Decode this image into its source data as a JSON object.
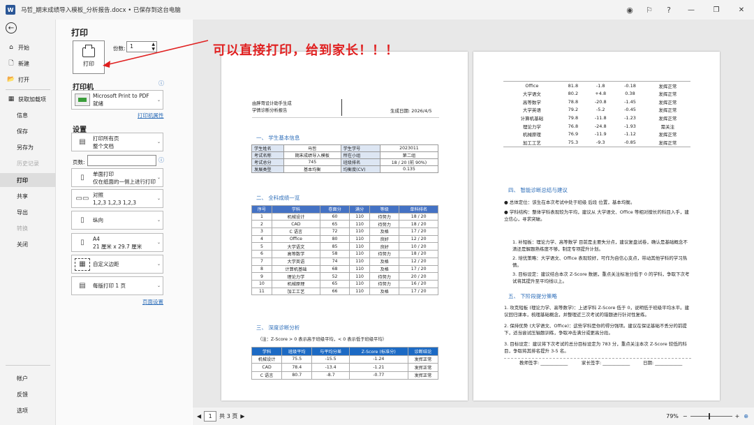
{
  "titlebar": {
    "app_icon": "W",
    "title": "马哲_期末成绩导入模板_分析报告.docx • 已保存到这台电脑"
  },
  "sidebar": {
    "items": [
      {
        "label": "开始",
        "icon": "⌂"
      },
      {
        "label": "新建",
        "icon": "🗋"
      },
      {
        "label": "打开",
        "icon": "📂"
      },
      {
        "label": "获取加载项",
        "icon": "▦"
      },
      {
        "label": "信息"
      },
      {
        "label": "保存"
      },
      {
        "label": "另存为"
      },
      {
        "label": "历史记录"
      },
      {
        "label": "打印"
      },
      {
        "label": "共享"
      },
      {
        "label": "导出"
      },
      {
        "label": "转换"
      },
      {
        "label": "关闭"
      }
    ],
    "bottom": [
      {
        "label": "帐户"
      },
      {
        "label": "反馈"
      },
      {
        "label": "选项"
      }
    ]
  },
  "print_panel": {
    "title": "打印",
    "print_button": "打印",
    "copies_label": "份数:",
    "copies_value": "1",
    "printer_section": "打印机",
    "printer_name": "Microsoft Print to PDF",
    "printer_status": "就绪",
    "printer_props": "打印机属性",
    "settings_section": "设置",
    "opt1_a": "打印所有页",
    "opt1_b": "整个文档",
    "pages_label": "页数:",
    "opt2_a": "单面打印",
    "opt2_b": "仅在纸面的一侧上进行打印",
    "opt3_a": "对照",
    "opt3_b": "1,2,3    1,2,3    1,2,3",
    "opt4_a": "纵向",
    "opt5_a": "A4",
    "opt5_b": "21 厘米 x 29.7 厘米",
    "opt6_a": "自定义边距",
    "opt7_a": "每版打印 1 页",
    "page_setup": "页面设置"
  },
  "annotation": "可以直接打印，给到家长！！！",
  "status": {
    "page": "1",
    "total": "共 3 页",
    "zoom": "79%"
  },
  "page1": {
    "header_left1": "由胖哥设计助手生成",
    "header_left2": "学情诊断分析报告",
    "header_right": "生成日期: 2026/4/5",
    "s1": "一、 学生基本信息",
    "info_rows": [
      [
        "学生姓名",
        "马哲",
        "学生学号",
        "2023011"
      ],
      [
        "考试名称",
        "期末成绩导入模板",
        "所在小组",
        "第二组"
      ],
      [
        "考试总分",
        "745",
        "班级排名",
        "18 / 20 (前 90%)"
      ],
      [
        "发展类型",
        "基本均衡",
        "均衡度(CV)",
        "0.135"
      ]
    ],
    "s2": "二、 全科成绩一览",
    "grade_header": [
      "序号",
      "学科",
      "卷面分",
      "满分",
      "等级",
      "单科排名"
    ],
    "grades": [
      [
        "1",
        "机械设计",
        "60",
        "110",
        "待努力",
        "18 / 20"
      ],
      [
        "2",
        "CAD",
        "65",
        "110",
        "待努力",
        "18 / 20"
      ],
      [
        "3",
        "C 语言",
        "72",
        "110",
        "及格",
        "17 / 20"
      ],
      [
        "4",
        "Office",
        "80",
        "110",
        "良好",
        "12 / 20"
      ],
      [
        "5",
        "大学语文",
        "85",
        "110",
        "良好",
        "10 / 20"
      ],
      [
        "6",
        "高等数学",
        "58",
        "110",
        "待努力",
        "18 / 20"
      ],
      [
        "7",
        "大学英语",
        "74",
        "110",
        "及格",
        "12 / 20"
      ],
      [
        "8",
        "计算机基础",
        "68",
        "110",
        "及格",
        "17 / 20"
      ],
      [
        "9",
        "理论力学",
        "52",
        "110",
        "待努力",
        "20 / 20"
      ],
      [
        "10",
        "机械原理",
        "65",
        "110",
        "待努力",
        "16 / 20"
      ],
      [
        "11",
        "加工工艺",
        "66",
        "110",
        "及格",
        "17 / 20"
      ]
    ],
    "s3": "三、 深度诊断分析",
    "note": "（注：Z-Score > 0 表示高于班级平均，< 0 表示低于班级平均）",
    "z_header": [
      "学科",
      "班级平均",
      "与平均分差",
      "Z-Score (标准分)",
      "诊断结论"
    ],
    "z_rows": [
      [
        "机械设计",
        "75.5",
        "-15.5",
        "-1.24",
        "发挥正常"
      ],
      [
        "CAD",
        "78.4",
        "-13.4",
        "-1.21",
        "发挥正常"
      ],
      [
        "C 语言",
        "80.7",
        "-8.7",
        "-0.77",
        "发挥正常"
      ]
    ]
  },
  "page2": {
    "z_rows": [
      [
        "Office",
        "81.8",
        "-1.8",
        "-0.18",
        "发挥正常"
      ],
      [
        "大学语文",
        "80.2",
        "+4.8",
        "0.38",
        "发挥正常"
      ],
      [
        "高等数学",
        "78.8",
        "-20.8",
        "-1.45",
        "发挥正常"
      ],
      [
        "大学英语",
        "79.2",
        "-5.2",
        "-0.45",
        "发挥正常"
      ],
      [
        "计算机基础",
        "79.8",
        "-11.8",
        "-1.23",
        "发挥正常"
      ],
      [
        "理论力学",
        "76.8",
        "-24.8",
        "-1.93",
        "需关注"
      ],
      [
        "机械原理",
        "76.9",
        "-11.9",
        "-1.12",
        "发挥正常"
      ],
      [
        "加工工艺",
        "75.3",
        "-9.3",
        "-0.85",
        "发挥正常"
      ]
    ],
    "s4": "四、 智能诊断总结与建议",
    "b1": "● 总体定位：该生在本次考试中处于班级 后段 位置，基本均衡。",
    "b2": "● 学科结构：整体学科表现较为平均，建议从 大学语文、Office 等相对擅长的科目入手，建立信心，寻求突破。",
    "l1": "1. 补短板：理论力学、高等数学 目前是主要失分点，建议复盘试卷，确认是基础概念不清还是解题熟练度不够，制定专项提升计划。",
    "l2": "2. 培优策略：大学语文、Office 表现较好，可作为自信心支点，带动其他学科的学习热情。",
    "l3": "3. 目标设定：建议结合本次 Z-Score 数据，重点关注标准分低于 0 的学科，争取下次考试将其提升至平均线以上。",
    "s5": "五、 下阶段提分策略",
    "p1": "1. 攻克短板 (理论力学、高等数学)：上述学科 Z-Score 低于 0，说明低于班级平均水平。建议回归课本，梳理基础概念，并整理近三次考试的错题进行针对性复练。",
    "p2": "2. 保持优势 (大学语文、Office)：这些学科是你的得分强项。建议在保证基础不丢分的前提下，适当尝试压轴题训练，争取冲击满分或更高分段。",
    "p3": "3. 目标设定：建议将下次考试的总分目标设定为 783 分，重点关注本次 Z-Score 较低的科目，争取将其排名提升 3-5 名。",
    "sign_teacher": "教师签字: ____________",
    "sign_parent": "家长签字: ____________",
    "sign_date": "日期: ____________"
  }
}
